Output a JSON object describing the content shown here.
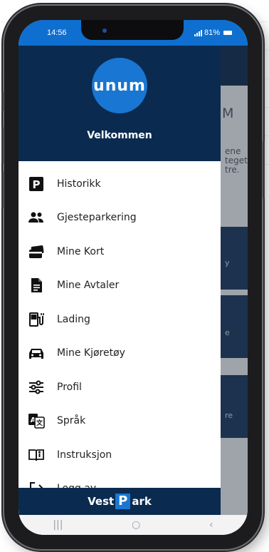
{
  "status_bar": {
    "time": "14:56",
    "battery": "81%"
  },
  "app": {
    "logo_text": "unum",
    "welcome": "Velkommen"
  },
  "menu": {
    "items": [
      {
        "label": "Historikk",
        "icon": "parking-icon"
      },
      {
        "label": "Gjesteparkering",
        "icon": "people-icon"
      },
      {
        "label": "Mine Kort",
        "icon": "cards-icon"
      },
      {
        "label": "Mine Avtaler",
        "icon": "document-icon"
      },
      {
        "label": "Lading",
        "icon": "ev-charger-icon"
      },
      {
        "label": "Mine Kjøretøy",
        "icon": "car-icon"
      },
      {
        "label": "Profil",
        "icon": "sliders-icon"
      },
      {
        "label": "Språk",
        "icon": "translate-icon"
      },
      {
        "label": "Instruksjon",
        "icon": "book-icon"
      },
      {
        "label": "Logg av",
        "icon": "logout-icon"
      }
    ]
  },
  "footer": {
    "brand_prefix": "Vest",
    "brand_badge": "P",
    "brand_suffix": "ark"
  },
  "background_page": {
    "title_fragment": "M",
    "text_fragment": "ene\nteget\ntre.",
    "card_texts": [
      "y",
      "e",
      "re"
    ]
  },
  "colors": {
    "header": "#0b2a4f",
    "accent": "#1976d2",
    "status_bar": "#0e6fd0"
  }
}
